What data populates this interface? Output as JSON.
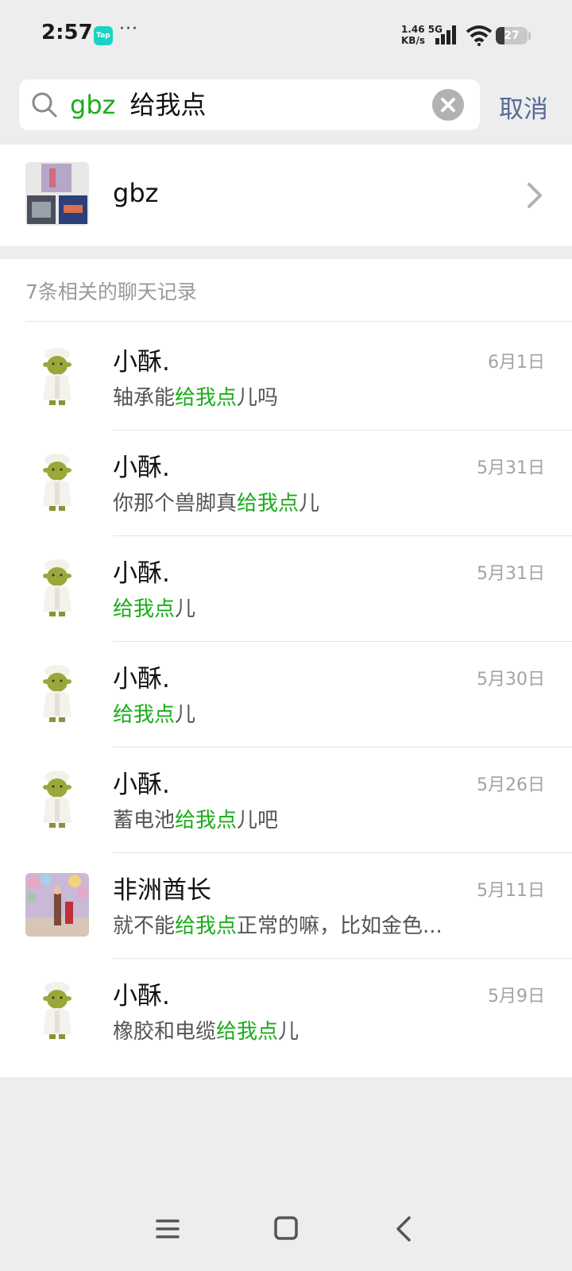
{
  "status_bar": {
    "time": "2:57",
    "app_badge": "Tap",
    "more": "···",
    "net_speed_value": "1.46 5G",
    "net_speed_unit": "KB/s",
    "battery_level": "27",
    "battery_fraction": 0.27
  },
  "search": {
    "keyword_contact": "gbz",
    "keyword_text": "给我点",
    "cancel_label": "取消"
  },
  "contact": {
    "name": "gbz"
  },
  "results": {
    "header": "7条相关的聊天记录",
    "items": [
      {
        "name": "小酥.",
        "date": "6月1日",
        "pre": "轴承能",
        "match": "给我点",
        "post": "儿吗",
        "avatar": "shrek"
      },
      {
        "name": "小酥.",
        "date": "5月31日",
        "pre": "你那个兽脚真",
        "match": "给我点",
        "post": "儿",
        "avatar": "shrek"
      },
      {
        "name": "小酥.",
        "date": "5月31日",
        "pre": "",
        "match": "给我点",
        "post": "儿",
        "avatar": "shrek"
      },
      {
        "name": "小酥.",
        "date": "5月30日",
        "pre": "",
        "match": "给我点",
        "post": "儿",
        "avatar": "shrek"
      },
      {
        "name": "小酥.",
        "date": "5月26日",
        "pre": "蓄电池",
        "match": "给我点",
        "post": "儿吧",
        "avatar": "shrek"
      },
      {
        "name": "非洲酋长",
        "date": "5月11日",
        "pre": "就不能",
        "match": "给我点",
        "post": "正常的嘛，比如金色...",
        "avatar": "photo"
      },
      {
        "name": "小酥.",
        "date": "5月9日",
        "pre": "橡胶和电缆",
        "match": "给我点",
        "post": "儿",
        "avatar": "shrek"
      }
    ]
  },
  "colors": {
    "highlight": "#1aad19",
    "cancel": "#576b95",
    "background": "#ededed"
  }
}
